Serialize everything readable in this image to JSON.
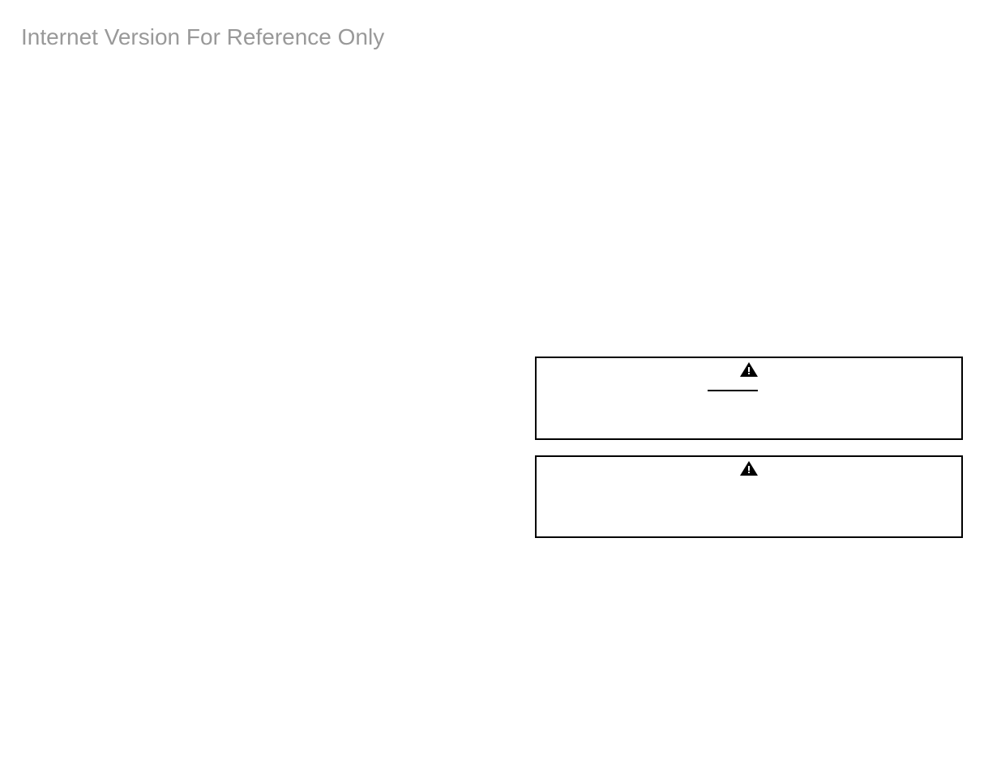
{
  "watermark": "Internet Version For Reference Only"
}
